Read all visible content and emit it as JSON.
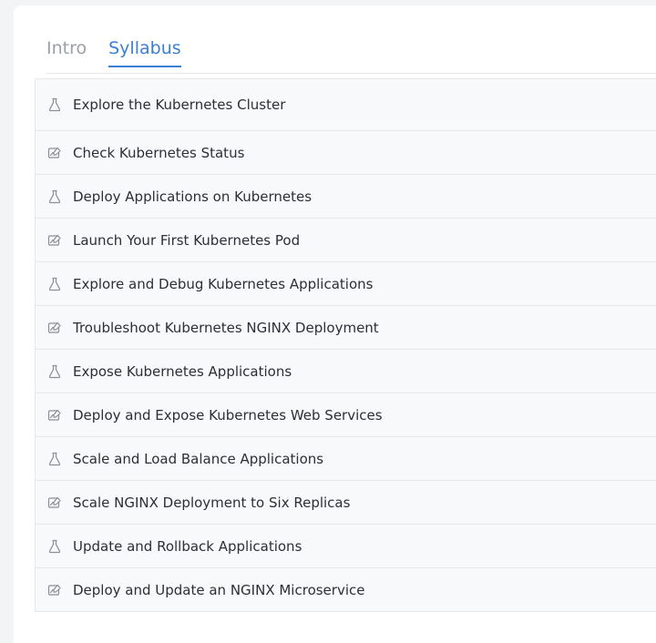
{
  "tabs": [
    {
      "label": "Intro",
      "active": false
    },
    {
      "label": "Syllabus",
      "active": true
    }
  ],
  "syllabus": [
    {
      "title": "Explore the Kubernetes Cluster",
      "icon": "flask-icon"
    },
    {
      "title": "Check Kubernetes Status",
      "icon": "challenge-icon"
    },
    {
      "title": "Deploy Applications on Kubernetes",
      "icon": "flask-icon"
    },
    {
      "title": "Launch Your First Kubernetes Pod",
      "icon": "challenge-icon"
    },
    {
      "title": "Explore and Debug Kubernetes Applications",
      "icon": "flask-icon"
    },
    {
      "title": "Troubleshoot Kubernetes NGINX Deployment",
      "icon": "challenge-icon"
    },
    {
      "title": "Expose Kubernetes Applications",
      "icon": "flask-icon"
    },
    {
      "title": "Deploy and Expose Kubernetes Web Services",
      "icon": "challenge-icon"
    },
    {
      "title": "Scale and Load Balance Applications",
      "icon": "flask-icon"
    },
    {
      "title": "Scale NGINX Deployment to Six Replicas",
      "icon": "challenge-icon"
    },
    {
      "title": "Update and Rollback Applications",
      "icon": "flask-icon"
    },
    {
      "title": "Deploy and Update an NGINX Microservice",
      "icon": "challenge-icon"
    }
  ],
  "colors": {
    "accent": "#3b7fd6",
    "tab_inactive": "#9aa0a8",
    "row_bg": "#f8f9fb",
    "text": "#2b2f36",
    "icon": "#8a8f98"
  }
}
